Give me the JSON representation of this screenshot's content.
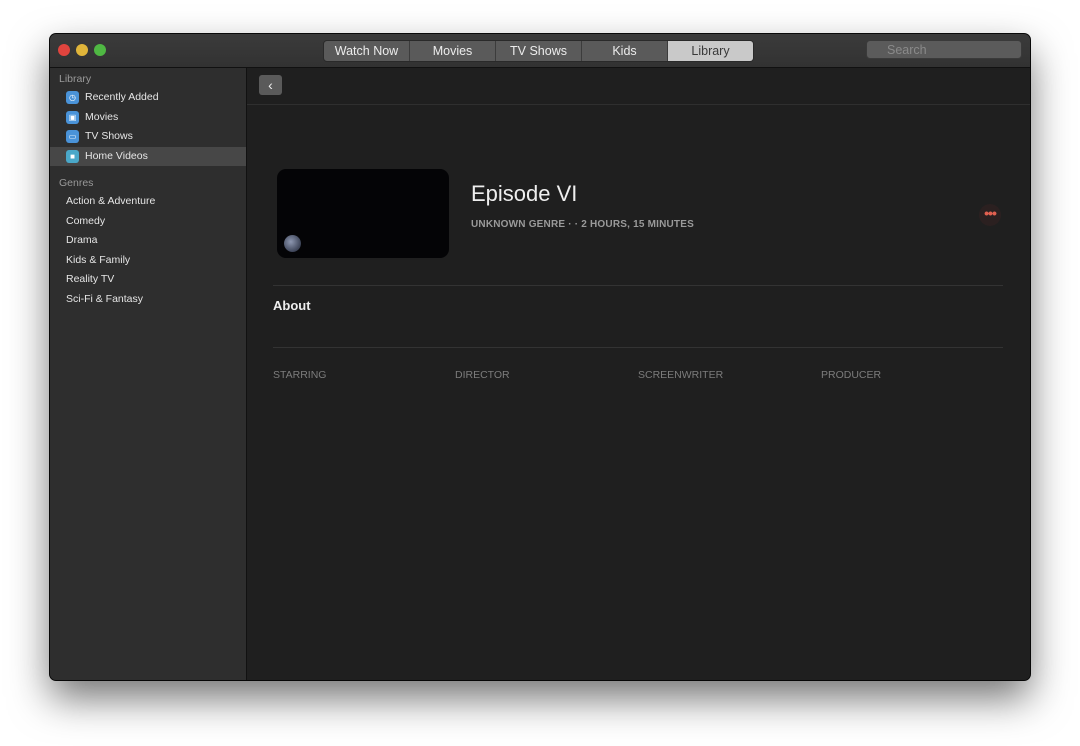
{
  "window": {
    "traffic_lights": [
      "close",
      "minimize",
      "maximize"
    ]
  },
  "nav_tabs": [
    {
      "label": "Watch Now",
      "active": false
    },
    {
      "label": "Movies",
      "active": false
    },
    {
      "label": "TV Shows",
      "active": false
    },
    {
      "label": "Kids",
      "active": false
    },
    {
      "label": "Library",
      "active": true
    }
  ],
  "search": {
    "placeholder": "Search",
    "value": ""
  },
  "sidebar": {
    "library_heading": "Library",
    "library_items": [
      {
        "label": "Recently Added",
        "icon": "clock-icon",
        "selected": false
      },
      {
        "label": "Movies",
        "icon": "film-icon",
        "selected": false
      },
      {
        "label": "TV Shows",
        "icon": "tv-icon",
        "selected": false
      },
      {
        "label": "Home Videos",
        "icon": "video-camera-icon",
        "selected": true
      }
    ],
    "genres_heading": "Genres",
    "genres": [
      {
        "label": "Action & Adventure"
      },
      {
        "label": "Comedy"
      },
      {
        "label": "Drama"
      },
      {
        "label": "Kids & Family"
      },
      {
        "label": "Reality TV"
      },
      {
        "label": "Sci-Fi & Fantasy"
      }
    ]
  },
  "toolbar": {
    "back_icon": "chevron-left-icon",
    "back_glyph": "‹"
  },
  "detail": {
    "title": "Episode VI",
    "meta": "UNKNOWN GENRE ·  · 2 HOURS, 15 MINUTES",
    "more_glyph": "•••",
    "about_heading": "About",
    "credits": [
      "STARRING",
      "DIRECTOR",
      "SCREENWRITER",
      "PRODUCER"
    ]
  },
  "colors": {
    "accent_more": "#e06050",
    "active_tab": "#c9c9c9",
    "sidebar_icon": "#4a93d8"
  }
}
